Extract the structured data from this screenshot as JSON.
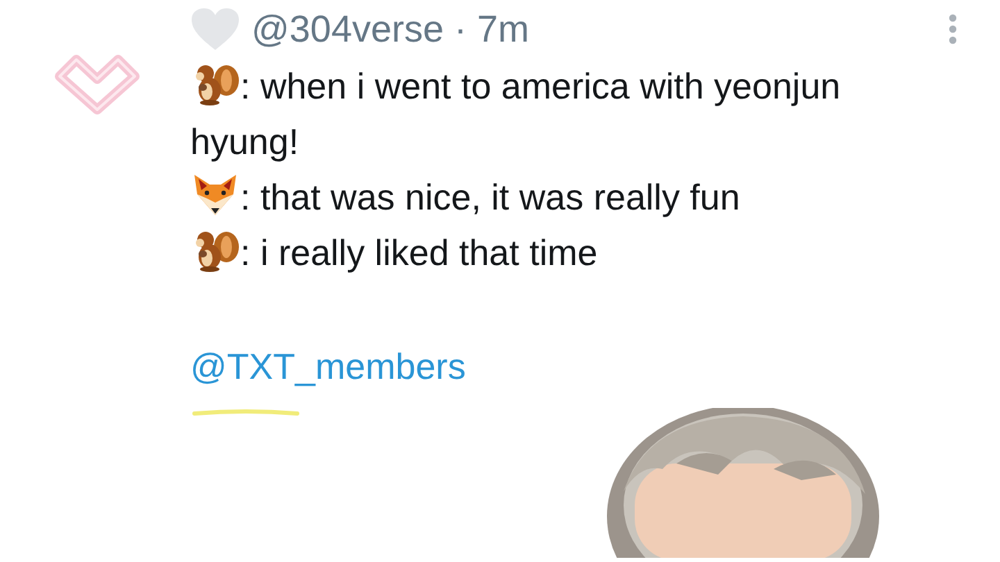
{
  "byline": "@304verse · 7m",
  "lines": [
    {
      "kind": "squirrel",
      "text": ": when i went to america with yeonjun hyung!"
    },
    {
      "kind": "fox",
      "text": ": that was nice, it was really fun"
    },
    {
      "kind": "squirrel",
      "text": ": i really liked that time"
    }
  ],
  "mention": "@TXT_members"
}
